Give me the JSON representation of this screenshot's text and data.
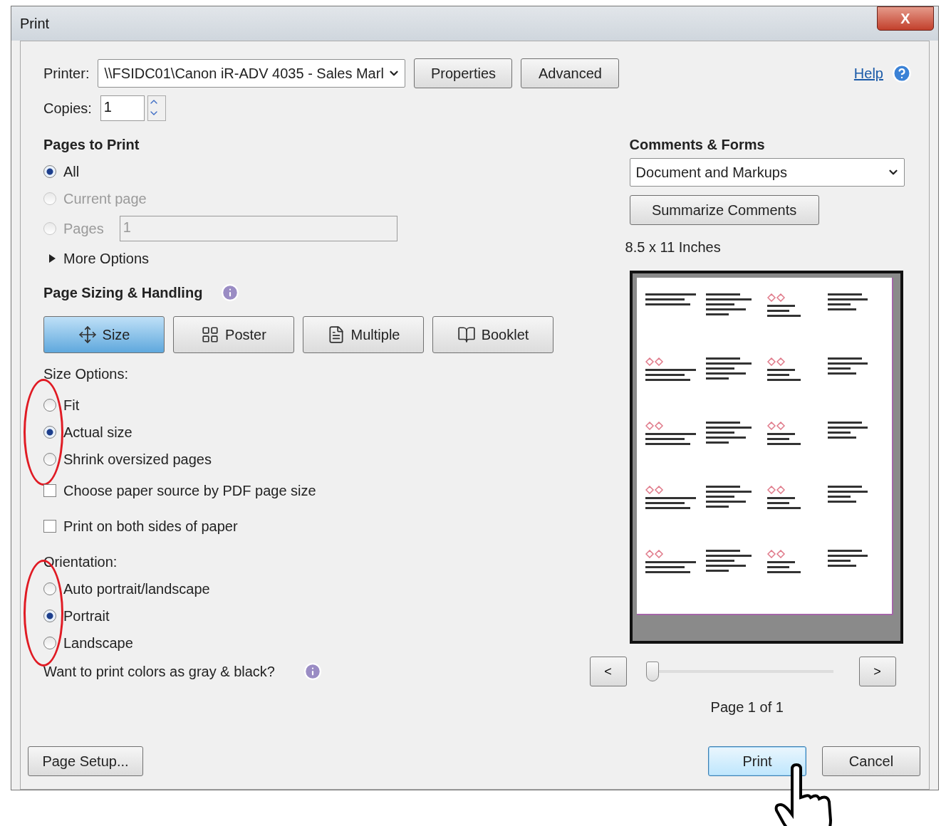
{
  "window": {
    "title": "Print",
    "close": "X"
  },
  "printer": {
    "label": "Printer:",
    "value": "\\\\FSIDC01\\Canon iR-ADV 4035 - Sales Marl"
  },
  "top_buttons": [
    "Properties",
    "Advanced"
  ],
  "help": {
    "label": "Help"
  },
  "copies": {
    "label": "Copies:",
    "value": "1"
  },
  "pages_to_print": {
    "heading": "Pages to Print",
    "options": [
      {
        "label": "All",
        "selected": true,
        "disabled": false
      },
      {
        "label": "Current page",
        "selected": false,
        "disabled": true
      },
      {
        "label": "Pages",
        "selected": false,
        "disabled": true,
        "field": "1"
      }
    ],
    "more_options": {
      "label": "More Options",
      "expanded": false
    }
  },
  "page_sizing": {
    "heading": "Page Sizing & Handling",
    "modes": [
      {
        "kind": "size",
        "label": "Size",
        "selected": true
      },
      {
        "kind": "poster",
        "label": "Poster",
        "selected": false
      },
      {
        "kind": "multiple",
        "label": "Multiple",
        "selected": false
      },
      {
        "kind": "booklet",
        "label": "Booklet",
        "selected": false
      }
    ],
    "size_options_label": "Size Options:",
    "size_options": [
      {
        "label": "Fit",
        "selected": false
      },
      {
        "label": "Actual size",
        "selected": true
      },
      {
        "label": "Shrink oversized pages",
        "selected": false
      }
    ],
    "checkboxes": [
      {
        "label": "Choose paper source by PDF page size",
        "checked": false
      },
      {
        "label": "Print on both sides of paper",
        "checked": false
      }
    ],
    "orientation_label": "Orientation:",
    "orientation": [
      {
        "label": "Auto portrait/landscape",
        "selected": false
      },
      {
        "label": "Portrait",
        "selected": true
      },
      {
        "label": "Landscape",
        "selected": false
      }
    ],
    "gray_question": "Want to print colors as gray & black?"
  },
  "comments_forms": {
    "heading": "Comments & Forms",
    "value": "Document and Markups",
    "summarize": "Summarize Comments"
  },
  "preview": {
    "paper_size": "8.5 x 11 Inches",
    "prev": "<",
    "next": ">",
    "slider": {
      "level": 0
    },
    "page_label": "Page 1 of 1"
  },
  "footer": {
    "page_setup": "Page Setup...",
    "buttons": [
      {
        "label": "Print",
        "default": true
      },
      {
        "label": "Cancel",
        "default": false
      }
    ]
  }
}
